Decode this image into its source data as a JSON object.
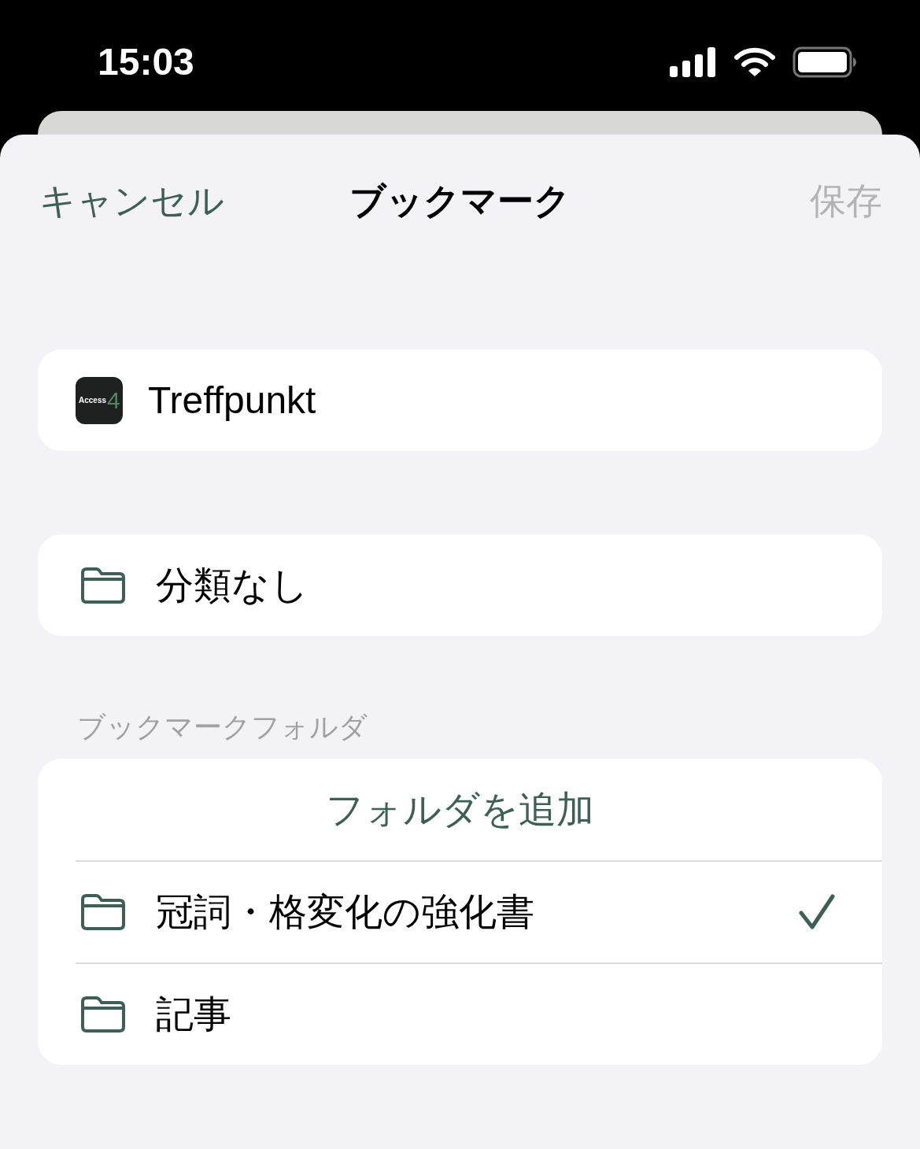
{
  "status_bar": {
    "time": "15:03"
  },
  "nav": {
    "cancel": "キャンセル",
    "title": "ブックマーク",
    "save": "保存",
    "save_disabled": true
  },
  "bookmark": {
    "app_icon_text": "Access",
    "app_icon_number": "4",
    "title": "Treffpunkt"
  },
  "category": {
    "label": "分類なし"
  },
  "folders_section": {
    "header": "ブックマークフォルダ",
    "add_button": "フォルダを追加",
    "items": [
      {
        "label": "冠詞・格変化の強化書",
        "selected": true
      },
      {
        "label": "記事",
        "selected": false
      }
    ]
  }
}
